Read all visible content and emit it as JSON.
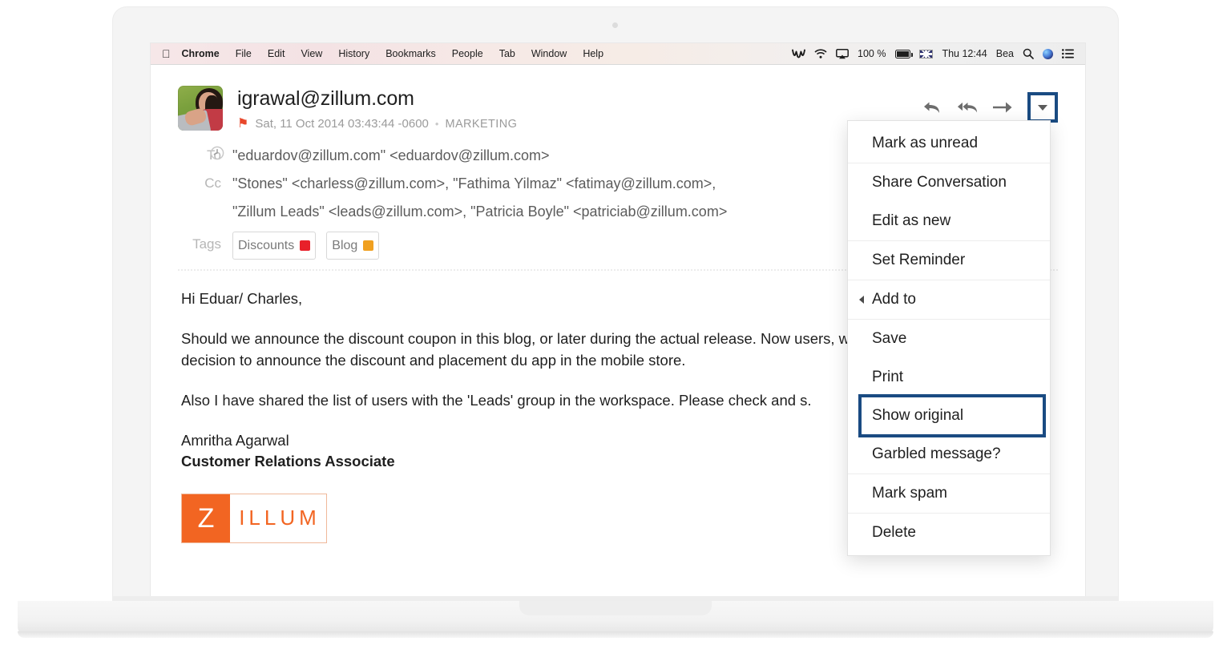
{
  "menubar": {
    "apple_icon": "apple-icon",
    "items": [
      "Chrome",
      "File",
      "Edit",
      "View",
      "History",
      "Bookmarks",
      "People",
      "Tab",
      "Window",
      "Help"
    ],
    "status": {
      "battery_percent": "100 %",
      "time": "Thu 12:44",
      "user": "Bea",
      "icons": [
        "mail-icon",
        "wifi-icon",
        "airplay-icon",
        "battery-icon",
        "flag-uk-icon",
        "search-icon",
        "siri-icon",
        "notifications-icon"
      ]
    }
  },
  "email": {
    "sender": "igrawal@zillum.com",
    "flag_icon": "flag-icon",
    "date": "Sat, 11 Oct 2014 03:43:44 -0600",
    "separator": "•",
    "category": "MARKETING",
    "to_label": "To",
    "to_value": "\"eduardov@zillum.com\" <eduardov@zillum.com>",
    "cc_label": "Cc",
    "cc_line1": "\"Stones\" <charless@zillum.com>, \"Fathima Yilmaz\" <fatimay@zillum.com>,",
    "cc_line2": "\"Zillum Leads\" <leads@zillum.com>, \"Patricia Boyle\" <patriciab@zillum.com>",
    "tags_label": "Tags",
    "tags": [
      {
        "label": "Discounts",
        "color": "#e8202a"
      },
      {
        "label": "Blog",
        "color": "#f0a020"
      }
    ],
    "body": {
      "greeting": "Hi Eduar/ Charles,",
      "paragraph1": "Should we announce the discount coupon in this blog, or later during the actual release. Now users, wouldnt it be a better marketing decision to announce the discount and placement du app in the mobile store.",
      "paragraph2": "Also I have shared the list of users with the 'Leads' group in the workspace. Please check and s.",
      "signature_name": "Amritha Agarwal",
      "signature_role": "Customer Relations Associate"
    },
    "logo": {
      "mark": "Z",
      "word": "ILLUM",
      "color": "#f26522"
    }
  },
  "toolbar": {
    "reply_label": "Reply",
    "reply_all_label": "Reply all",
    "forward_label": "Forward",
    "more_label": "More options"
  },
  "dropdown": {
    "highlight_color": "#1a4b82",
    "groups": [
      {
        "items": [
          {
            "label": "Mark as unread",
            "submenu": false,
            "highlighted": false
          }
        ]
      },
      {
        "items": [
          {
            "label": "Share Conversation",
            "submenu": false,
            "highlighted": false
          },
          {
            "label": "Edit as new",
            "submenu": false,
            "highlighted": false
          }
        ]
      },
      {
        "items": [
          {
            "label": "Set Reminder",
            "submenu": false,
            "highlighted": false
          }
        ]
      },
      {
        "items": [
          {
            "label": "Add to",
            "submenu": true,
            "highlighted": false
          }
        ]
      },
      {
        "items": [
          {
            "label": "Save",
            "submenu": false,
            "highlighted": false
          },
          {
            "label": "Print",
            "submenu": false,
            "highlighted": false
          },
          {
            "label": "Show original",
            "submenu": false,
            "highlighted": true
          },
          {
            "label": "Garbled message?",
            "submenu": false,
            "highlighted": false
          }
        ]
      },
      {
        "items": [
          {
            "label": "Mark spam",
            "submenu": false,
            "highlighted": false
          }
        ]
      },
      {
        "items": [
          {
            "label": "Delete",
            "submenu": false,
            "highlighted": false
          }
        ]
      }
    ]
  }
}
